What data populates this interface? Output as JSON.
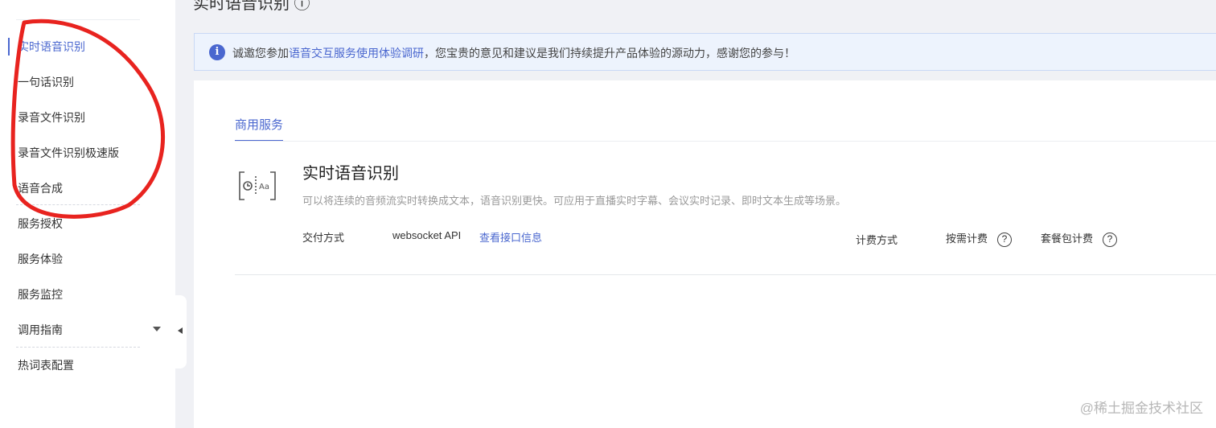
{
  "header": {
    "title_fragment": "实时语音识别 ⓘ"
  },
  "sidebar": {
    "items": [
      {
        "label": "实时语音识别"
      },
      {
        "label": "一句话识别"
      },
      {
        "label": "录音文件识别"
      },
      {
        "label": "录音文件识别极速版"
      },
      {
        "label": "语音合成"
      },
      {
        "label": "服务授权"
      },
      {
        "label": "服务体验"
      },
      {
        "label": "服务监控"
      },
      {
        "label": "调用指南"
      },
      {
        "label": "热词表配置"
      }
    ]
  },
  "notice": {
    "prefix": "诚邀您参加",
    "link": "语音交互服务使用体验调研",
    "suffix": "，您宝贵的意见和建议是我们持续提升产品体验的源动力，感谢您的参与！"
  },
  "tabs": [
    {
      "label": "商用服务"
    }
  ],
  "service": {
    "title": "实时语音识别",
    "description": "可以将连续的音频流实时转换成文本，语音识别更快。可应用于直播实时字幕、会议实时记录、即时文本生成等场景。",
    "delivery_label": "交付方式",
    "delivery_value": "websocket API",
    "delivery_link": "查看接口信息",
    "billing_label": "计费方式",
    "billing_on_demand": "按需计费",
    "billing_package": "套餐包计费"
  },
  "watermark": "@稀土掘金技术社区",
  "colors": {
    "accent": "#4a67cf",
    "annotation": "#e8231f"
  }
}
